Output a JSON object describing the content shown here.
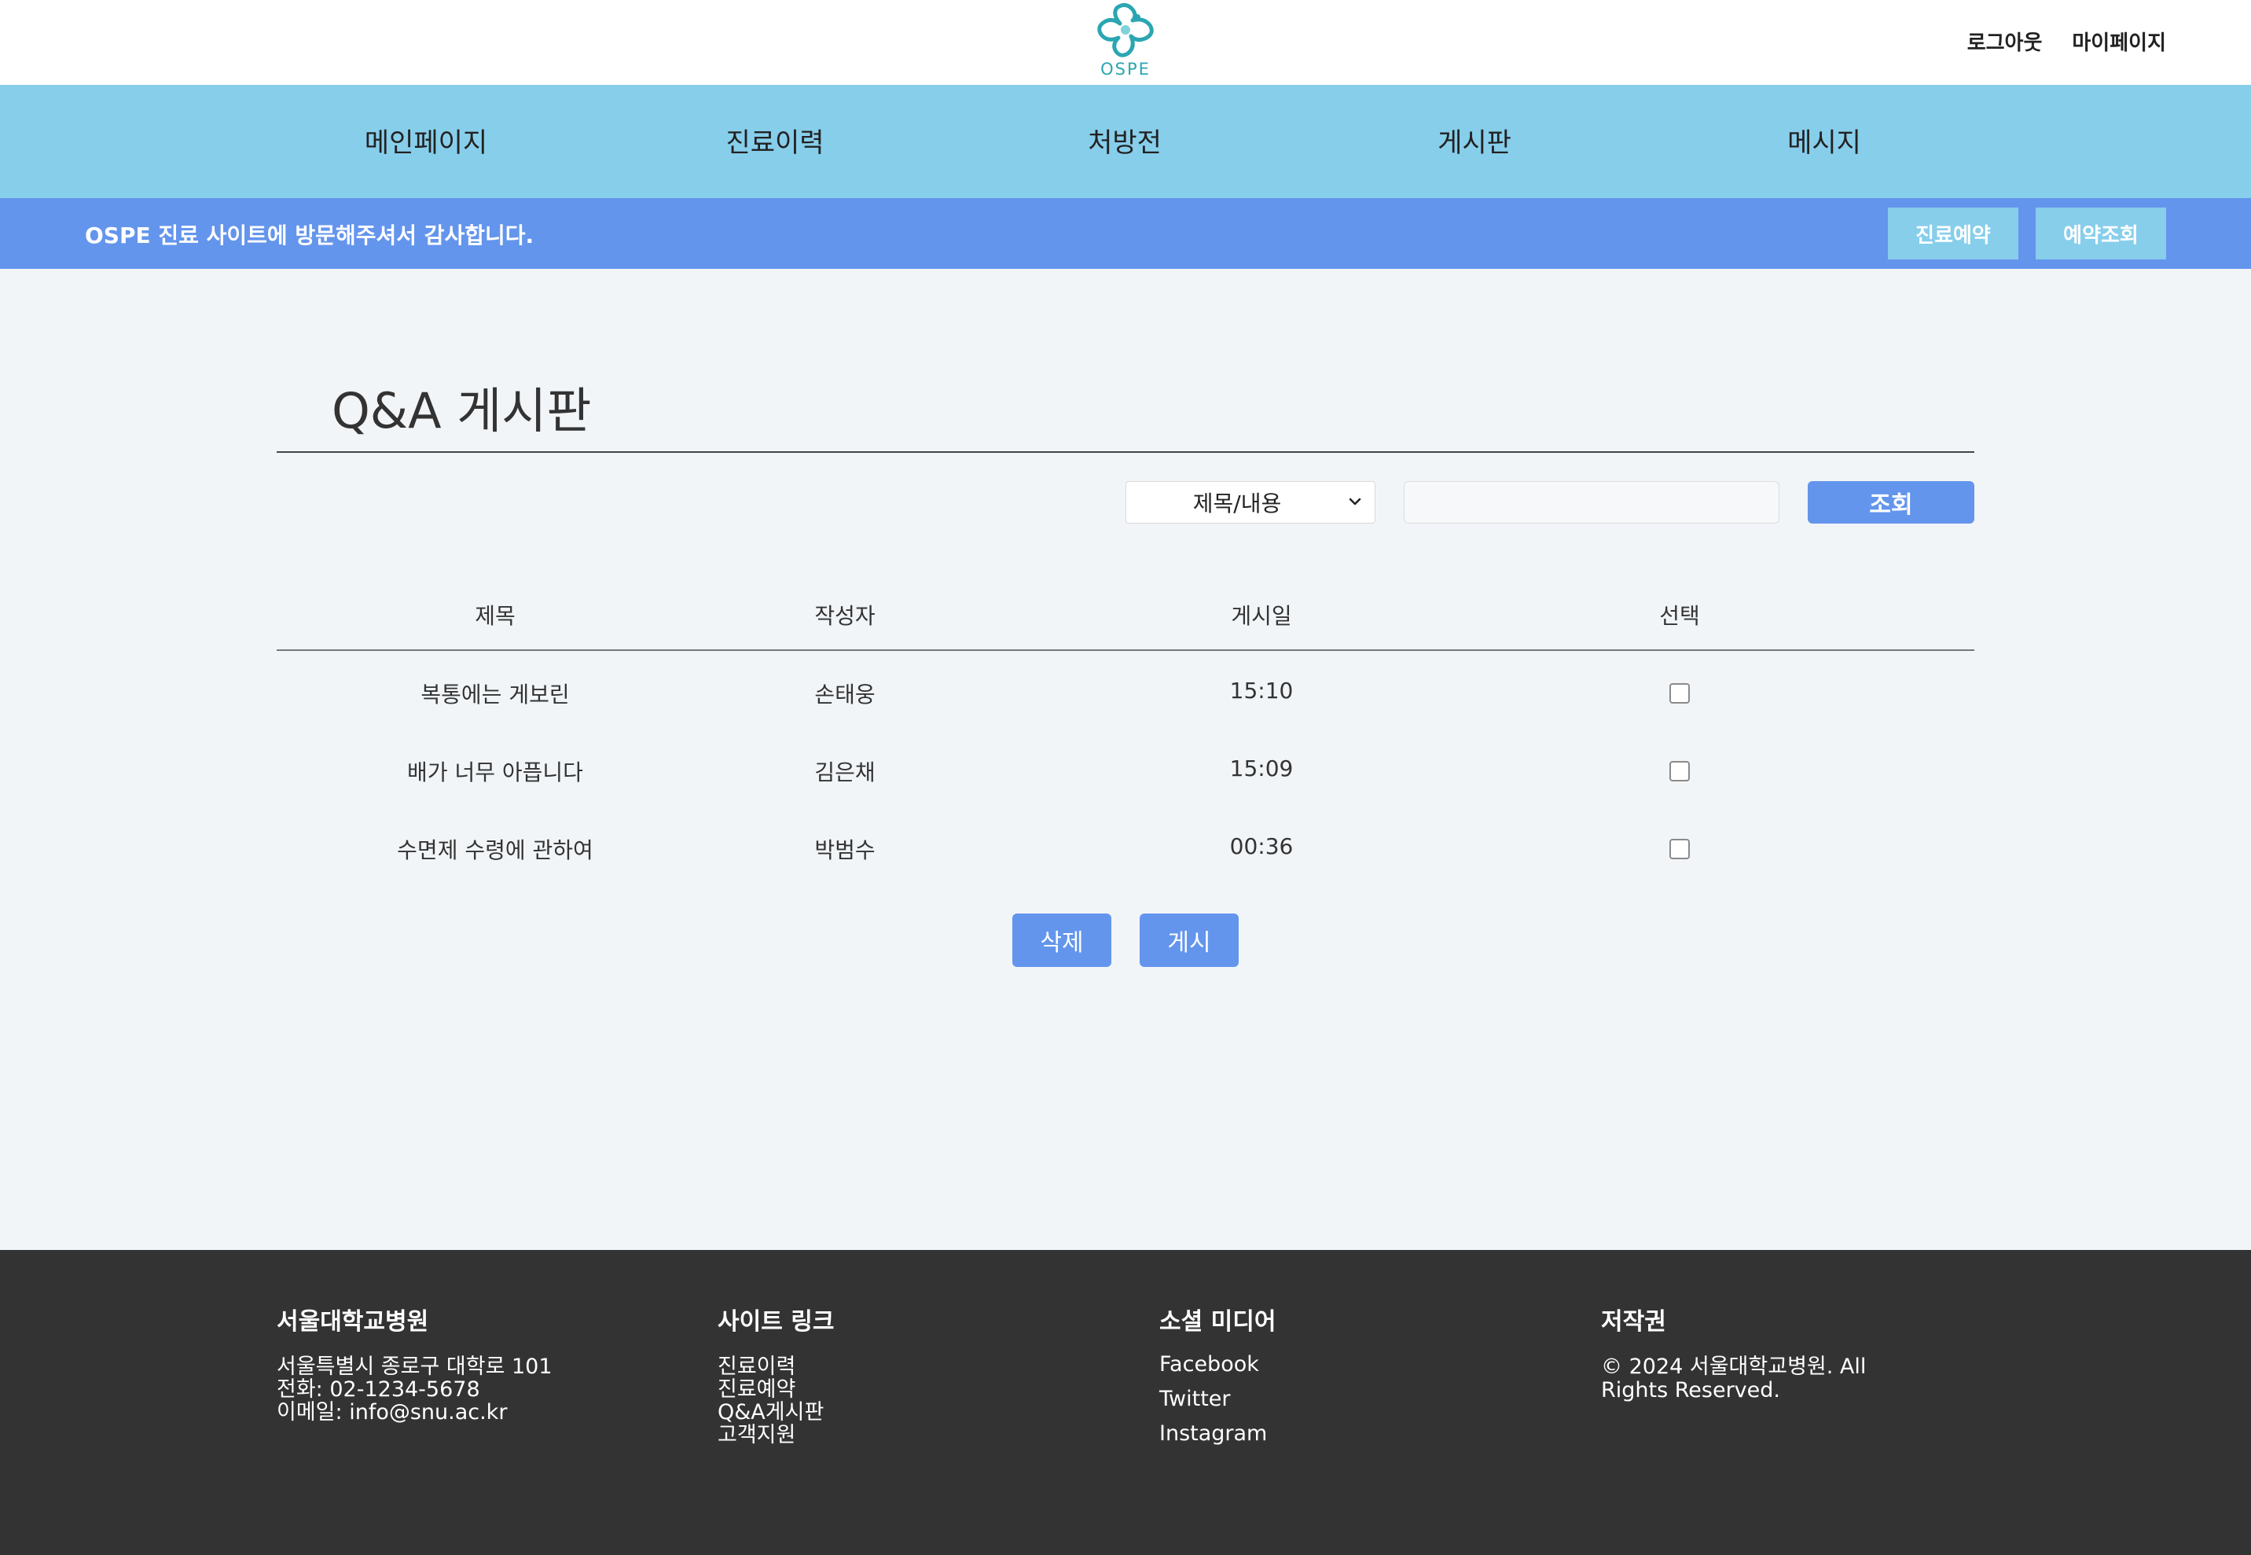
{
  "header": {
    "logo_text": "OSPE",
    "logout_label": "로그아웃",
    "mypage_label": "마이페이지"
  },
  "nav": {
    "items": [
      {
        "label": "메인페이지"
      },
      {
        "label": "진료이력"
      },
      {
        "label": "처방전"
      },
      {
        "label": "게시판"
      },
      {
        "label": "메시지"
      }
    ]
  },
  "welcome": {
    "text": "OSPE 진료 사이트에 방문해주셔서 감사합니다.",
    "reserve_label": "진료예약",
    "lookup_label": "예약조회"
  },
  "board": {
    "title": "Q&A 게시판",
    "search_select_value": "제목/내용",
    "search_input_value": "",
    "search_button_label": "조회",
    "columns": [
      "제목",
      "작성자",
      "게시일",
      "선택"
    ],
    "rows": [
      {
        "title": "복통에는 게보린",
        "author": "손태웅",
        "date": "15:10",
        "checked": false
      },
      {
        "title": "배가 너무 아픕니다",
        "author": "김은채",
        "date": "15:09",
        "checked": false
      },
      {
        "title": "수면제 수령에 관하여",
        "author": "박범수",
        "date": "00:36",
        "checked": false
      }
    ],
    "delete_label": "삭제",
    "post_label": "게시"
  },
  "footer": {
    "hospital": {
      "title": "서울대학교병원",
      "lines": [
        "서울특별시 종로구 대학로 101",
        "전화: 02-1234-5678",
        "이메일: info@snu.ac.kr"
      ]
    },
    "links": {
      "title": "사이트 링크",
      "items": [
        "진료이력",
        "진료예약",
        "Q&A게시판",
        "고객지원"
      ]
    },
    "social": {
      "title": "소셜 미디어",
      "items": [
        "Facebook",
        "Twitter",
        "Instagram"
      ]
    },
    "copyright": {
      "title": "저작권",
      "text": "© 2024 서울대학교병원. All Rights Reserved."
    }
  },
  "colors": {
    "nav_bg": "#87ceeb",
    "welcome_bg": "#6495ed",
    "accent_button": "#6495ed",
    "footer_bg": "#333333",
    "page_bg": "#f2f5f8",
    "logo_teal": "#2aa6b2"
  },
  "icons": {
    "logo": "medical-cross-logo-icon",
    "select_caret": "chevron-down-icon"
  }
}
